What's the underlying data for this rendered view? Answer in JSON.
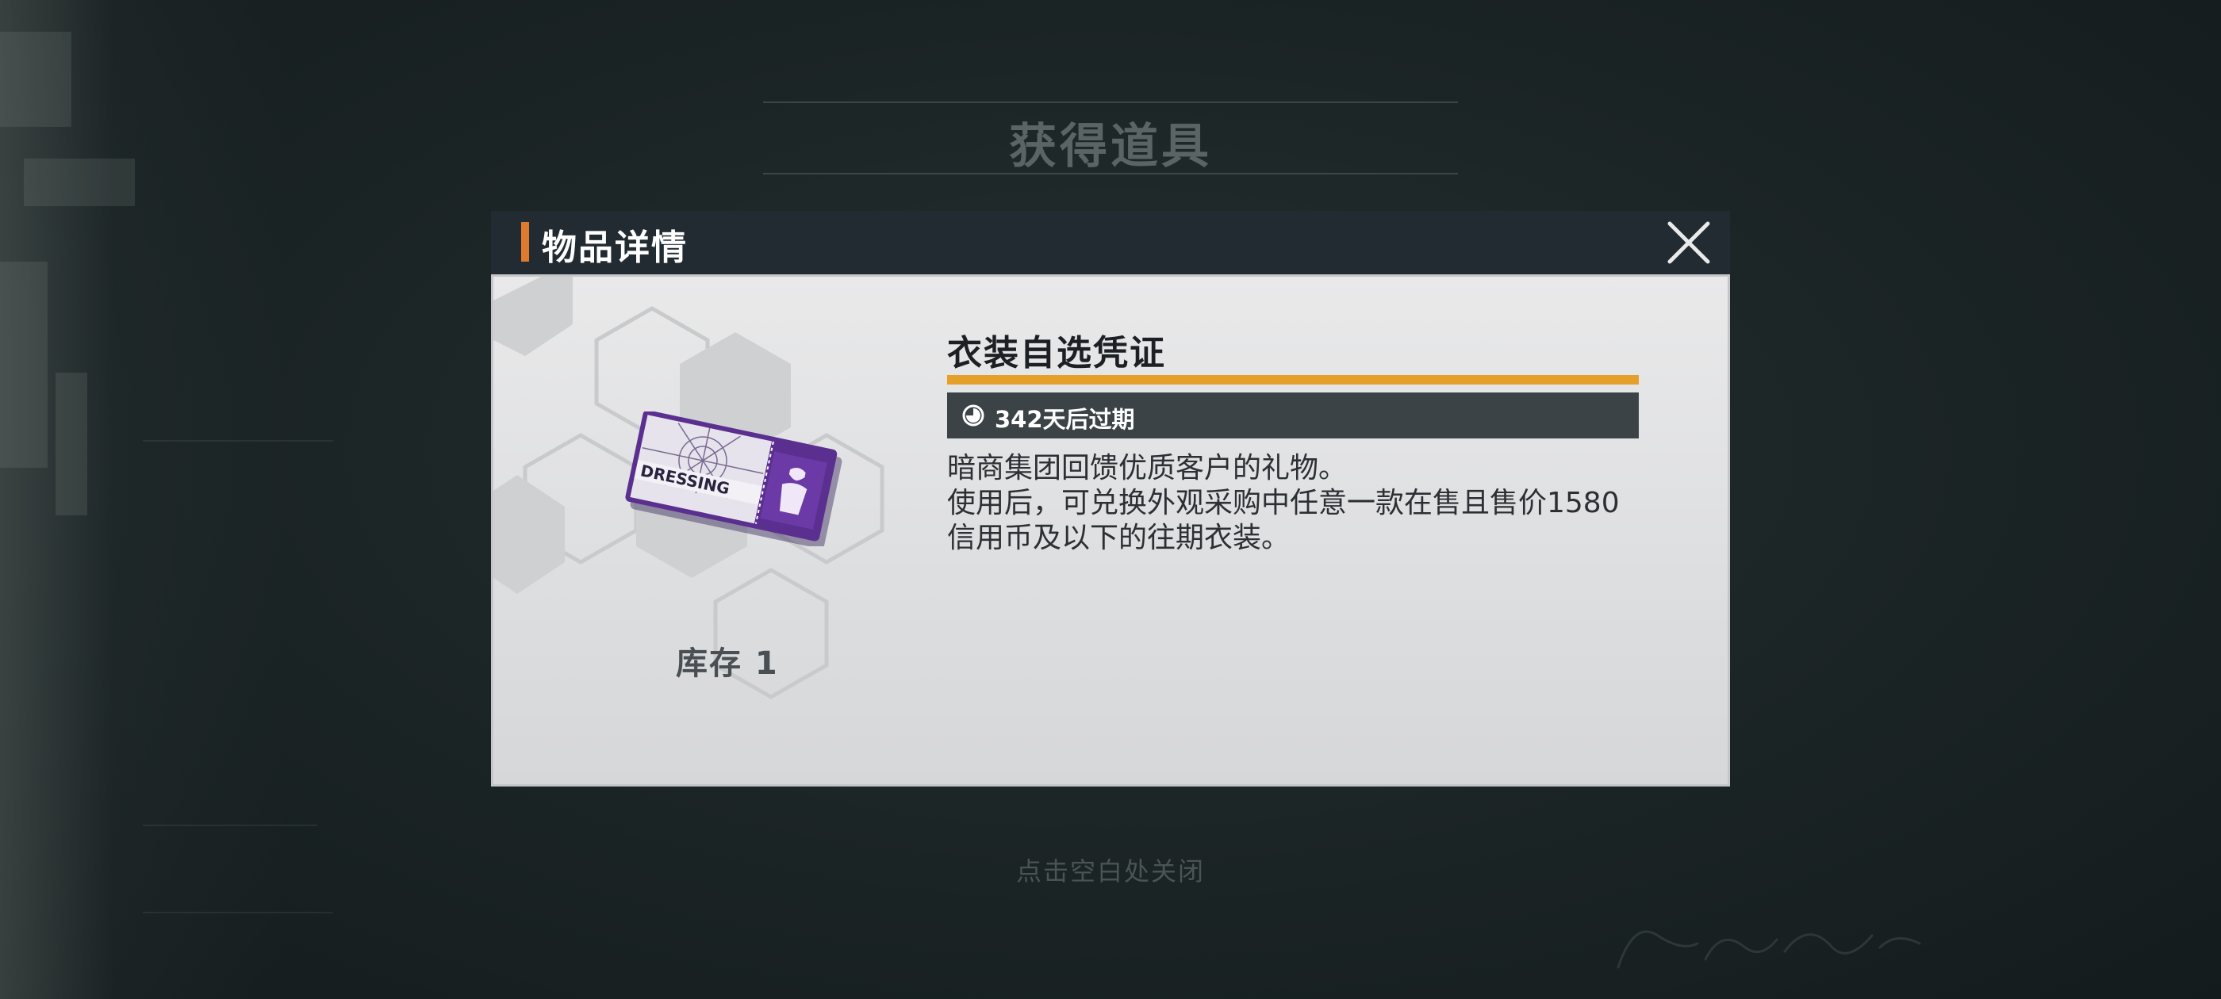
{
  "overlay": {
    "title": "获得道具",
    "close_hint": "点击空白处关闭"
  },
  "dialog": {
    "header_title": "物品详情",
    "close_icon": "close-icon",
    "accent_color": "#e07a2c"
  },
  "item": {
    "name": "衣装自选凭证",
    "icon": "dressing-ticket-icon",
    "ticket_text": "DRESSING",
    "stock_label": "库存 1",
    "expire_text": "342天后过期",
    "expire_icon": "clock-icon",
    "description": "暗商集团回馈优质客户的礼物。\n使用后，可兑换外观采购中任意一款在售且售价1580信用币及以下的往期衣装。",
    "name_bar_color": "#e5a02a"
  }
}
